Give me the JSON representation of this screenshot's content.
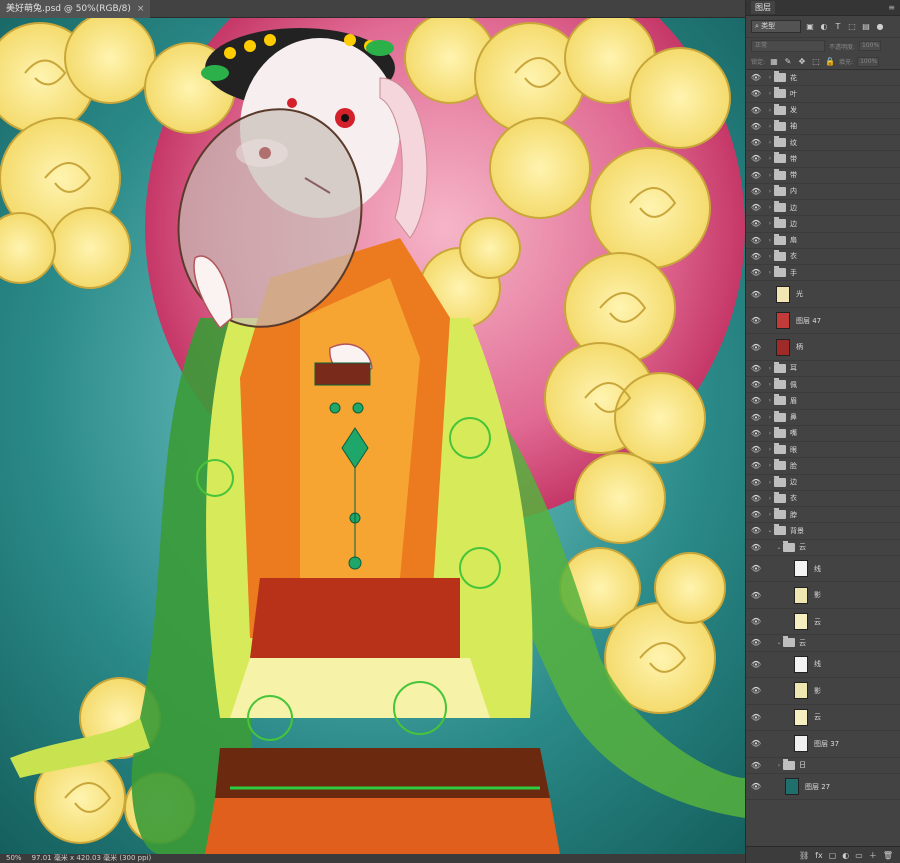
{
  "document": {
    "tab_title": "美好萌兔.psd @ 50%(RGB/8)",
    "close_glyph": "×"
  },
  "status": {
    "zoom": "50%",
    "doc_size": "97.01 毫米 x 420.03 毫米 (300 ppi)"
  },
  "panel": {
    "title": "图层",
    "menu_glyph": "≡",
    "filter_kind": "类型",
    "blend_mode": "正常",
    "opacity_label": "不透明度:",
    "opacity_value": "100%",
    "lock_label": "锁定:",
    "fill_label": "填充:",
    "fill_value": "100%"
  },
  "layers": [
    {
      "name": "花",
      "type": "group",
      "indent": 1,
      "visible": true
    },
    {
      "name": "叶",
      "type": "group",
      "indent": 1,
      "visible": true
    },
    {
      "name": "发",
      "type": "group",
      "indent": 1,
      "visible": true
    },
    {
      "name": "袖",
      "type": "group",
      "indent": 1,
      "visible": true
    },
    {
      "name": "纹",
      "type": "group",
      "indent": 1,
      "visible": true
    },
    {
      "name": "带",
      "type": "group",
      "indent": 1,
      "visible": true
    },
    {
      "name": "带",
      "type": "group",
      "indent": 1,
      "visible": true
    },
    {
      "name": "内",
      "type": "group",
      "indent": 1,
      "visible": true
    },
    {
      "name": "边",
      "type": "group",
      "indent": 1,
      "visible": true
    },
    {
      "name": "边",
      "type": "group",
      "indent": 1,
      "visible": true
    },
    {
      "name": "扇",
      "type": "group",
      "indent": 1,
      "visible": true
    },
    {
      "name": "衣",
      "type": "group",
      "indent": 1,
      "visible": true
    },
    {
      "name": "手",
      "type": "group",
      "indent": 1,
      "visible": true
    },
    {
      "name": "光",
      "type": "layer",
      "indent": 1,
      "visible": true,
      "thumb": "#f1e6b4"
    },
    {
      "name": "图层 47",
      "type": "layer",
      "indent": 1,
      "visible": true,
      "thumb": "#c23b3b"
    },
    {
      "name": "柄",
      "type": "layer",
      "indent": 1,
      "visible": true,
      "thumb": "#a02a2a"
    },
    {
      "name": "耳",
      "type": "group",
      "indent": 1,
      "visible": true
    },
    {
      "name": "佩",
      "type": "group",
      "indent": 1,
      "visible": true
    },
    {
      "name": "眉",
      "type": "group",
      "indent": 1,
      "visible": true
    },
    {
      "name": "鼻",
      "type": "group",
      "indent": 1,
      "visible": true
    },
    {
      "name": "嘴",
      "type": "group",
      "indent": 1,
      "visible": true
    },
    {
      "name": "眼",
      "type": "group",
      "indent": 1,
      "visible": true
    },
    {
      "name": "脸",
      "type": "group",
      "indent": 1,
      "visible": true
    },
    {
      "name": "边",
      "type": "group",
      "indent": 1,
      "visible": true
    },
    {
      "name": "衣",
      "type": "group",
      "indent": 1,
      "visible": true
    },
    {
      "name": "脖",
      "type": "group",
      "indent": 1,
      "visible": true
    },
    {
      "name": "背景",
      "type": "group-open",
      "indent": 1,
      "visible": true
    },
    {
      "name": "云",
      "type": "group-open",
      "indent": 2,
      "visible": true
    },
    {
      "name": "线",
      "type": "layer",
      "indent": 3,
      "visible": true,
      "thumb": "#f3f3f3"
    },
    {
      "name": "影",
      "type": "layer",
      "indent": 3,
      "visible": true,
      "thumb": "#efe7b2"
    },
    {
      "name": "云",
      "type": "layer",
      "indent": 3,
      "visible": true,
      "thumb": "#f6efbf"
    },
    {
      "name": "云",
      "type": "group-open",
      "indent": 2,
      "visible": true
    },
    {
      "name": "线",
      "type": "layer",
      "indent": 3,
      "visible": true,
      "thumb": "#f3f3f3"
    },
    {
      "name": "影",
      "type": "layer",
      "indent": 3,
      "visible": true,
      "thumb": "#efe7b2"
    },
    {
      "name": "云",
      "type": "layer",
      "indent": 3,
      "visible": true,
      "thumb": "#f6efbf"
    },
    {
      "name": "图层 37",
      "type": "layer",
      "indent": 3,
      "visible": true,
      "thumb": "#f0f0f0"
    },
    {
      "name": "日",
      "type": "group",
      "indent": 2,
      "visible": true
    },
    {
      "name": "图层 27",
      "type": "layer",
      "indent": 2,
      "visible": true,
      "thumb": "#1f6f6c"
    }
  ],
  "panel_bottom_icons": [
    "link-icon",
    "fx-icon",
    "mask-icon",
    "adjustment-icon",
    "group-icon",
    "new-layer-icon",
    "trash-icon"
  ],
  "panel_bottom_glyphs": [
    "⛓",
    "fx",
    "▢",
    "◐",
    "▭",
    "＋",
    "🗑"
  ],
  "colors": {
    "canvas_bg": "#1c6b6a",
    "sun": "#d94a7a",
    "cloud": "#f6e27a",
    "robe_orange": "#e8731f",
    "robe_green": "#d9ec5a"
  }
}
